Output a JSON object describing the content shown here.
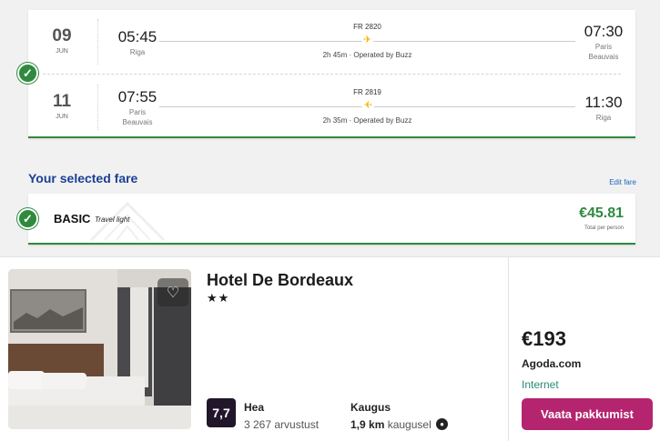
{
  "flight": {
    "outbound": {
      "day": "09",
      "month": "JUN",
      "dep_time": "05:45",
      "dep_city": "Riga",
      "flight_no": "FR 2820",
      "duration": "2h 45m · Operated by Buzz",
      "arr_time": "07:30",
      "arr_city_1": "Paris",
      "arr_city_2": "Beauvais"
    },
    "return": {
      "day": "11",
      "month": "JUN",
      "dep_time": "07:55",
      "dep_city_1": "Paris",
      "dep_city_2": "Beauvais",
      "flight_no": "FR 2819",
      "duration": "2h 35m · Operated by Buzz",
      "arr_time": "11:30",
      "arr_city": "Riga"
    }
  },
  "fare": {
    "section_title": "Your selected fare",
    "edit_label": "Edit fare",
    "name": "BASIC",
    "subtitle": "Travel light",
    "price": "€45.81",
    "price_note": "Total per person"
  },
  "hotel": {
    "name": "Hotel De Bordeaux",
    "stars": "★★",
    "rating": "7,7",
    "rating_word": "Hea",
    "reviews": "3 267 arvustust",
    "distance_label": "Kaugus",
    "distance_value": "1,9 km",
    "distance_suffix": " kaugusel",
    "price": "€193",
    "provider": "Agoda.com",
    "internet": "Internet",
    "deal_button": "Vaata pakkumist"
  },
  "colors": {
    "accent_green": "#2f8a3e",
    "title_blue": "#1a3f94",
    "plane_yellow": "#f2b600",
    "deal_button": "#b5256f"
  },
  "icons": [
    "check-icon",
    "plane-icon",
    "heart-icon",
    "info-icon"
  ]
}
